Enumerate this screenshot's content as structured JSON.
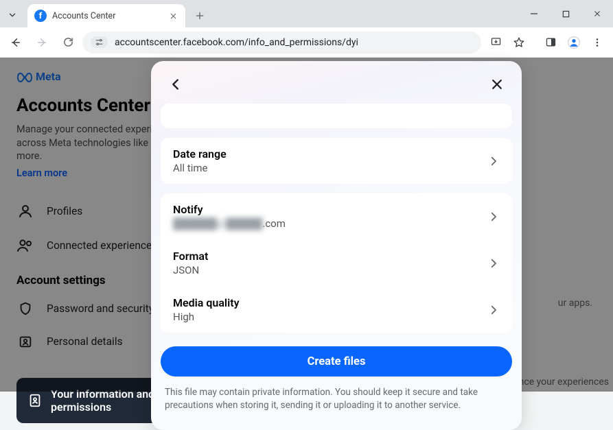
{
  "browser": {
    "tab_title": "Accounts Center",
    "url": "accountscenter.facebook.com/info_and_permissions/dyi"
  },
  "page": {
    "brand": "Meta",
    "title": "Accounts Center",
    "subtitle": "Manage your connected experiences and account settings across Meta technologies like Facebook, Instagram and more.",
    "learn_more": "Learn more",
    "nav": {
      "profiles": "Profiles",
      "connected": "Connected experiences"
    },
    "section": "Account settings",
    "settings": {
      "password": "Password and security",
      "personal": "Personal details",
      "info_chip": "Your information and permissions"
    },
    "right_hints": {
      "apps": "ur apps.",
      "experiences": "nce your experiences"
    }
  },
  "modal": {
    "rows": {
      "date_range": {
        "label": "Date range",
        "value": "All time"
      },
      "notify": {
        "label": "Notify",
        "value_prefix": "██████@█████",
        "value_suffix": ".com"
      },
      "format": {
        "label": "Format",
        "value": "JSON"
      },
      "media": {
        "label": "Media quality",
        "value": "High"
      }
    },
    "cta": "Create files",
    "notice": "This file may contain private information. You should keep it secure and take precautions when storing it, sending it or uploading it to another service."
  }
}
